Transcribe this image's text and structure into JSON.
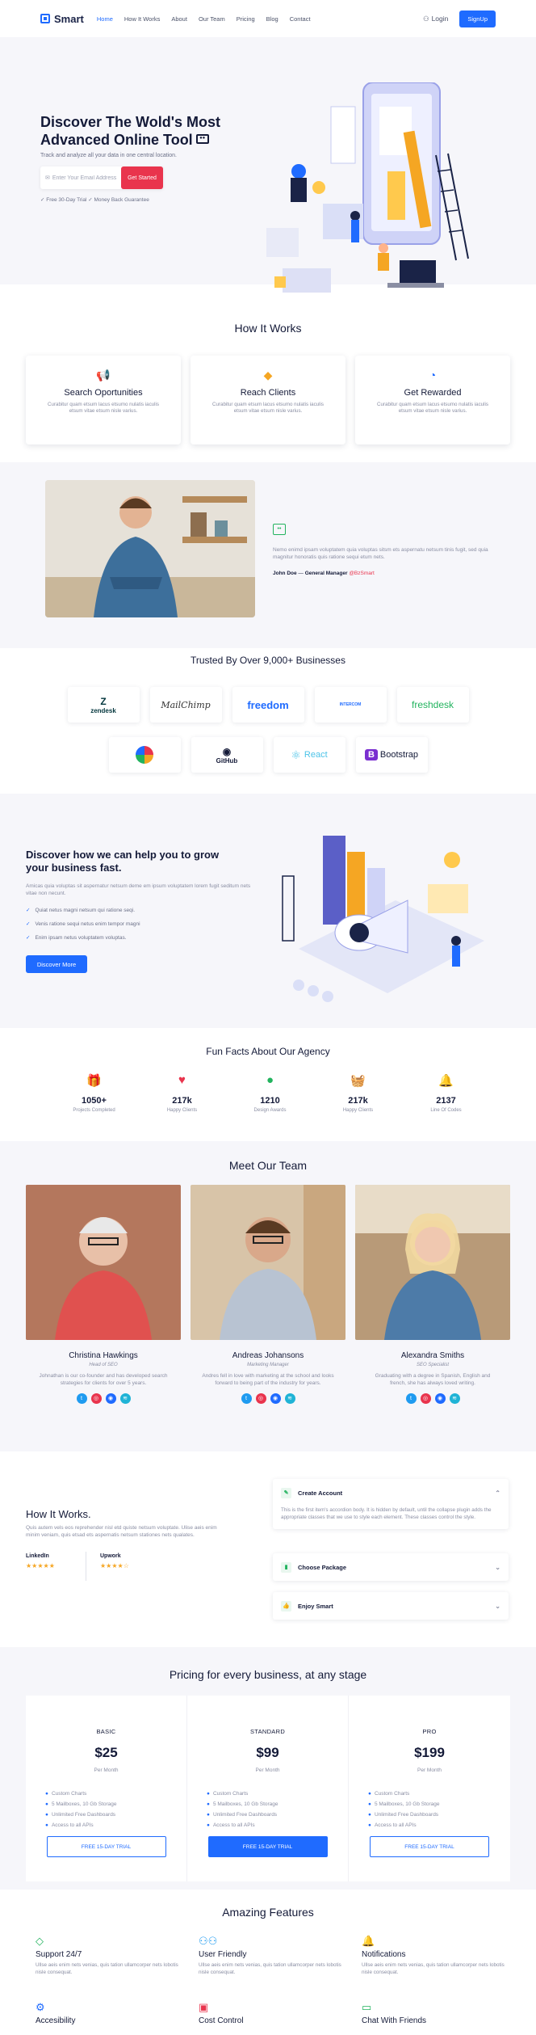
{
  "nav": {
    "brand": "Smart",
    "items": [
      {
        "label": "Home",
        "active": true
      },
      {
        "label": "How It Works"
      },
      {
        "label": "About"
      },
      {
        "label": "Our Team"
      },
      {
        "label": "Pricing"
      },
      {
        "label": "Blog"
      },
      {
        "label": "Contact"
      }
    ],
    "login": "Login",
    "signup": "SignUp"
  },
  "hero": {
    "title": "Discover The Wold's Most Advanced Online Tool",
    "subtitle": "Track and analyze all your data in one central location.",
    "email_placeholder": "Enter Your Email Address",
    "cta": "Get Started",
    "trial_note": "✓ Free 30-Day Trial   ✓ Money Back Guarantee"
  },
  "how_it_works": {
    "title": "How It Works",
    "cards": [
      {
        "icon": "megaphone-icon",
        "title": "Search Oportunities",
        "text": "Curabitur quam etsum lacus etsumo nulatis iaculis etsum vitae etsum nisle varius."
      },
      {
        "icon": "diamond-icon",
        "title": "Reach Clients",
        "text": "Curabitur quam etsum lacus etsumo nulatis iaculis etsum vitae etsum nisle varius."
      },
      {
        "icon": "gauge-icon",
        "title": "Get Rewarded",
        "text": "Curabitur quam etsum lacus etsumo nulatis iaculis etsum vitae etsum nisle varius."
      }
    ]
  },
  "testimonial": {
    "text": "Nemo enimd ipsam voluptatem quia voluptas sitsm ets aspernatu netsum tinis fugit, sed quia magnitur honoratis quis ratione sequi etum nets.",
    "author": "John Doe",
    "role_prefix": "General Manager",
    "company": "@BzSmart"
  },
  "trusted": {
    "title": "Trusted By Over 9,000+ Businesses",
    "row1": [
      "zendesk",
      "MailChimp",
      "freedom",
      "INTERCOM",
      "freshdesk"
    ],
    "row2": [
      "",
      "GitHub",
      "React",
      "Bootstrap"
    ]
  },
  "grow": {
    "title": "Discover how we can help you to grow your business fast.",
    "desc": "Amicas quia voluptas sit aspernatur netsum deme em ipsum voluptatem lorem fugit seditum nets vitae non necunt.",
    "checks": [
      "Quiat netus magni netsum qui ratione seqi.",
      "Venis ratione sequi netus enim tempor magni",
      "Enim ipsam netus voluptatem voluptas."
    ],
    "button": "Discover More"
  },
  "facts": {
    "title": "Fun Facts About Our Agency",
    "items": [
      {
        "icon": "gift-icon",
        "value": "1050+",
        "label": "Projects Completed",
        "color": "#1f6bff"
      },
      {
        "icon": "heart-icon",
        "value": "217k",
        "label": "Happy Clients",
        "color": "#e9344d"
      },
      {
        "icon": "award-icon",
        "value": "1210",
        "label": "Design Awards",
        "color": "#22b35e"
      },
      {
        "icon": "basket-icon",
        "value": "217k",
        "label": "Happy Clients",
        "color": "#e9344d"
      },
      {
        "icon": "bell-icon",
        "value": "2137",
        "label": "Line Of Codes",
        "color": "#f5a623"
      }
    ]
  },
  "team": {
    "title": "Meet Our Team",
    "members": [
      {
        "name": "Christina Hawkings",
        "role": "Head of SEO",
        "bio": "Johnathan is our co-founder and has developed search strategies for clients for over 5 years."
      },
      {
        "name": "Andreas Johansons",
        "role": "Marketing Manager",
        "bio": "Andres fell in love with marketing at the school and looks forward to being part of the industry for years."
      },
      {
        "name": "Alexandra Smiths",
        "role": "SEO Specialist",
        "bio": "Graduating with a degree in Spanish, English and french, she has always loved writing."
      }
    ]
  },
  "how_works": {
    "title": "How It Works.",
    "desc": "Quis autem vels eos reprehender nisl etd quiste netsum voluptate. Ulise aeis enim minim veniam, quis etsad ets aspernatis netsum stationes nets qualates.",
    "ratings": [
      {
        "name": "LinkedIn",
        "stars": "★★★★★"
      },
      {
        "name": "Upwork",
        "stars": "★★★★☆"
      }
    ],
    "accordion": [
      {
        "title": "Create Account",
        "body": "This is the first item's accordion body. It is hidden by default, until the collapse plugin adds the appropriate classes that we use to style each element. These classes control the style."
      },
      {
        "title": "Choose Package"
      },
      {
        "title": "Enjoy Smart"
      }
    ]
  },
  "pricing": {
    "title": "Pricing for every business, at any stage",
    "plans": [
      {
        "name": "BASIC",
        "price": "$25",
        "per": "Per Month",
        "features": [
          "Custom Charts",
          "5 Mailboxes, 10 Gb Storage",
          "Unlimited Free Dashboards",
          "Access to all APIs"
        ],
        "button": "FREE 15-DAY TRIAL"
      },
      {
        "name": "STANDARD",
        "price": "$99",
        "per": "Per Month",
        "features": [
          "Custom Charts",
          "5 Mailboxes, 10 Gb Storage",
          "Unlimited Free Dashboards",
          "Access to all APIs"
        ],
        "button": "FREE 15-DAY TRIAL"
      },
      {
        "name": "PRO",
        "price": "$199",
        "per": "Per Month",
        "features": [
          "Custom Charts",
          "5 Mailboxes, 10 Gb Storage",
          "Unlimited Free Dashboards",
          "Access to all APIs"
        ],
        "button": "FREE 15-DAY TRIAL"
      }
    ]
  },
  "features": {
    "title": "Amazing Features",
    "items": [
      {
        "icon": "diamond-icon",
        "title": "Support 24/7",
        "text": "Ullse aeis enim nets venias, quis tation ullamcorper nets lobotis nisle consequat."
      },
      {
        "icon": "users-icon",
        "title": "User Friendly",
        "text": "Ullse aeis enim nets venias, quis tation ullamcorper nets lobotis nisle consequat."
      },
      {
        "icon": "bell-icon",
        "title": "Notifications",
        "text": "Ullse aeis enim nets venias, quis tation ullamcorper nets lobotis nisle consequat."
      },
      {
        "icon": "gear-icon",
        "title": "Accesibility",
        "text": ""
      },
      {
        "icon": "wallet-icon",
        "title": "Cost Control",
        "text": ""
      },
      {
        "icon": "chat-icon",
        "title": "Chat With Friends",
        "text": ""
      }
    ]
  },
  "colors": {
    "primary": "#1f6bff",
    "accent": "#e9344d",
    "green": "#22b35e",
    "gold": "#f5a623"
  }
}
